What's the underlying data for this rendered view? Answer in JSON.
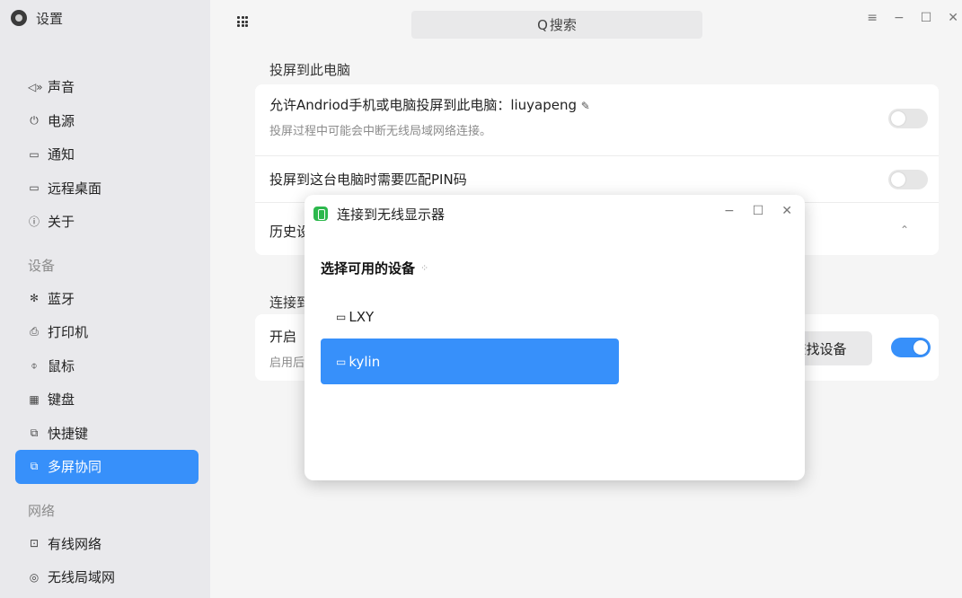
{
  "app": {
    "title": "设置"
  },
  "sidebar": {
    "items": [
      {
        "type": "item",
        "icon": "speaker-icon",
        "glyph": "◁»",
        "label": "声音"
      },
      {
        "type": "item",
        "icon": "power-icon",
        "glyph": "⏻",
        "label": "电源"
      },
      {
        "type": "item",
        "icon": "notification-icon",
        "glyph": "▭",
        "label": "通知"
      },
      {
        "type": "item",
        "icon": "remote-desktop-icon",
        "glyph": "▭",
        "label": "远程桌面"
      },
      {
        "type": "item",
        "icon": "info-icon",
        "glyph": "ⓘ",
        "label": "关于"
      },
      {
        "type": "group",
        "label": "设备"
      },
      {
        "type": "item",
        "icon": "bluetooth-icon",
        "glyph": "✻",
        "label": "蓝牙"
      },
      {
        "type": "item",
        "icon": "printer-icon",
        "glyph": "⎙",
        "label": "打印机"
      },
      {
        "type": "item",
        "icon": "mouse-icon",
        "glyph": "⌽",
        "label": "鼠标"
      },
      {
        "type": "item",
        "icon": "keyboard-icon",
        "glyph": "▦",
        "label": "键盘"
      },
      {
        "type": "item",
        "icon": "shortcut-icon",
        "glyph": "⧉",
        "label": "快捷键"
      },
      {
        "type": "item",
        "icon": "multiscreen-icon",
        "glyph": "⧉",
        "label": "多屏协同",
        "active": true
      },
      {
        "type": "group",
        "label": "网络"
      },
      {
        "type": "item",
        "icon": "wired-network-icon",
        "glyph": "⊡",
        "label": "有线网络"
      },
      {
        "type": "item",
        "icon": "wlan-icon",
        "glyph": "◎",
        "label": "无线局域网"
      }
    ]
  },
  "topbar": {
    "search_placeholder": "搜索",
    "search_icon": "Q"
  },
  "main": {
    "section1_title": "投屏到此电脑",
    "allow_label": "允许Andriod手机或电脑投屏到此电脑：liuyapeng",
    "allow_note": "投屏过程中可能会中断无线局域网络连接。",
    "pin_label": "投屏到这台电脑时需要匹配PIN码",
    "history_label": "历史设",
    "section2_title": "连接到",
    "open_label": "开启",
    "enable_note": "启用后",
    "find_button": "查找设备",
    "toggles": {
      "allow": false,
      "pin": false,
      "open": true
    }
  },
  "dialog": {
    "title": "连接到无线显示器",
    "heading": "选择可用的设备",
    "devices": [
      {
        "name": "LXY",
        "selected": false
      },
      {
        "name": "kylin",
        "selected": true
      }
    ]
  },
  "colors": {
    "accent": "#3790fa",
    "sidebar_bg": "#e9e9ec",
    "app_icon_green": "#2db84d"
  }
}
